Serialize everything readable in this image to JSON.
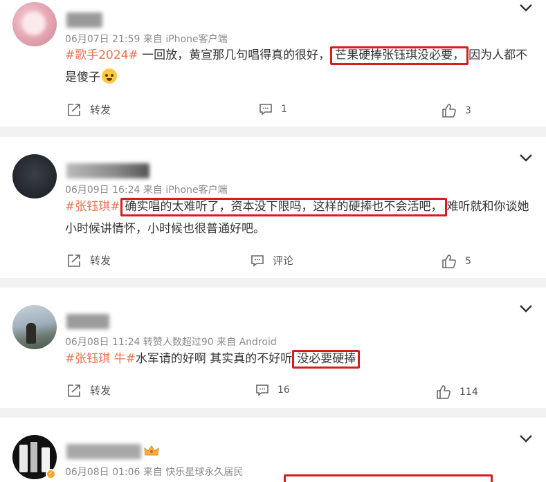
{
  "colors": {
    "link_orange": "#eb7350",
    "highlight_red": "#d51d1d",
    "meta_gray": "#8a8a8a"
  },
  "posts": [
    {
      "meta": "06月07日 21:59  来自 iPhone客户端",
      "tag": "#歌手2024#",
      "text_before": " 一回放，黄宣那几句唱得真的很好，",
      "highlight": "芒果硬捧张钰琪没必要，",
      "text_after": "因为人都不是傻子",
      "repost_label": "转发",
      "comment_count": "1",
      "like_count": "3"
    },
    {
      "meta": "06月09日 16:24  来自 iPhone客户端",
      "tag": "#张钰琪#",
      "highlight": "确实唱的太难听了，资本没下限吗，这样的硬捧也不会活吧，",
      "text_after": "难听就和你谈她小时候讲情怀，小时候也很普通好吧。",
      "repost_label": "转发",
      "comment_label": "评论",
      "like_count": "5"
    },
    {
      "meta": "06月08日 11:24  转赞人数超过90  来自 Android",
      "tag": "#张钰琪 牛#",
      "text_before": "水军请的好啊 其实真的不好听",
      "highlight": "没必要硬捧",
      "repost_label": "转发",
      "comment_count": "16",
      "like_count": "114"
    },
    {
      "meta": "06月08日 01:06  来自 快乐星球永久居民"
    }
  ],
  "icons": [
    "chevron-down-icon",
    "repost-icon",
    "comment-icon",
    "like-icon",
    "verified-badge-icon",
    "crown-badge-icon",
    "cry-emoji-icon"
  ]
}
